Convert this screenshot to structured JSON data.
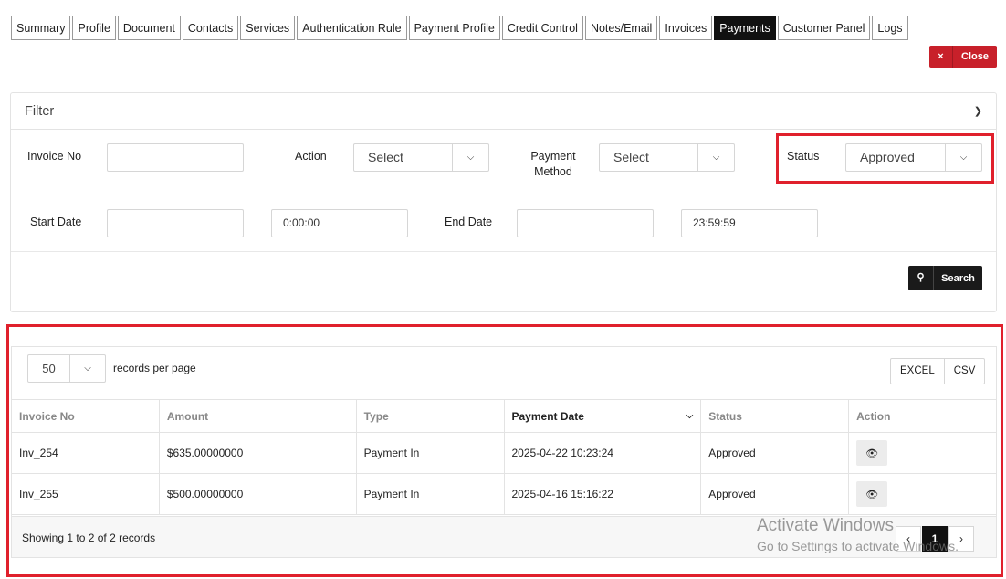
{
  "tabs": [
    "Summary",
    "Profile",
    "Document",
    "Contacts",
    "Services",
    "Authentication Rule",
    "Payment Profile",
    "Credit Control",
    "Notes/Email",
    "Invoices",
    "Payments",
    "Customer Panel",
    "Logs"
  ],
  "active_tab": "Payments",
  "close_button": {
    "icon": "×",
    "label": "Close"
  },
  "filter": {
    "title": "Filter",
    "invoice_no_label": "Invoice No",
    "invoice_no_value": "",
    "action_label": "Action",
    "action_value": "Select",
    "payment_method_label_1": "Payment",
    "payment_method_label_2": "Method",
    "payment_method_value": "Select",
    "status_label": "Status",
    "status_value": "Approved",
    "start_date_label": "Start Date",
    "start_date_value": "",
    "start_time_value": "0:00:00",
    "end_date_label": "End Date",
    "end_date_value": "",
    "end_time_value": "23:59:59",
    "search_label": "Search"
  },
  "results": {
    "per_page": "50",
    "per_page_label": "records per page",
    "export_buttons": [
      "EXCEL",
      "CSV"
    ],
    "columns": [
      "Invoice No",
      "Amount",
      "Type",
      "Payment Date",
      "Status",
      "Action"
    ],
    "sorted_column": "Payment Date",
    "rows": [
      {
        "invoice": "Inv_254",
        "amount": "$635.00000000",
        "type": "Payment In",
        "date": "2025-04-22 10:23:24",
        "status": "Approved"
      },
      {
        "invoice": "Inv_255",
        "amount": "$500.00000000",
        "type": "Payment In",
        "date": "2025-04-16 15:16:22",
        "status": "Approved"
      }
    ],
    "showing_text": "Showing 1 to 2 of 2 records",
    "pager": {
      "prev": "‹",
      "current": "1",
      "next": "›"
    }
  },
  "watermark": {
    "line1": "Activate Windows",
    "line2": "Go to Settings to activate Windows."
  },
  "colors": {
    "accent_red": "#c8202a",
    "highlight_red": "#e0202c",
    "dark": "#111111"
  }
}
